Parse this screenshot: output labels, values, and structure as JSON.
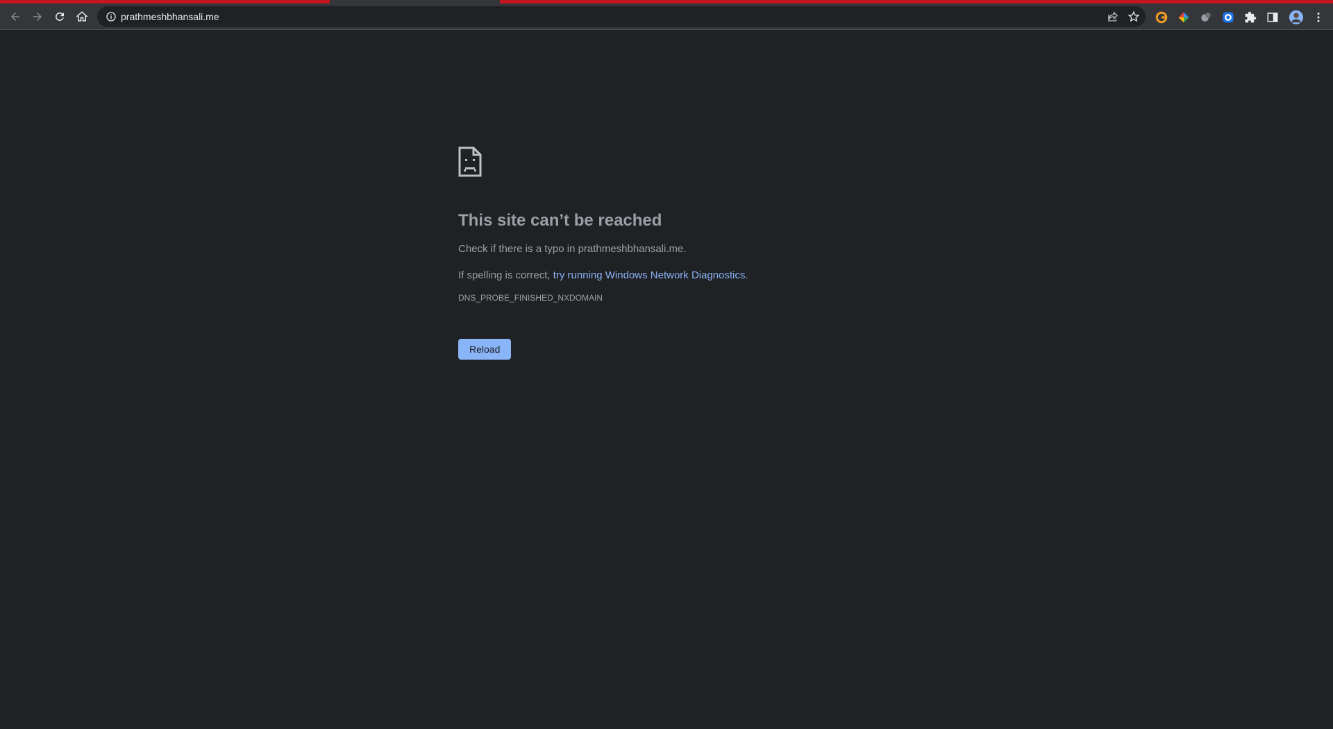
{
  "browser": {
    "url": "prathmeshbhansali.me",
    "nav": {
      "back": "back-icon",
      "forward": "forward-icon",
      "reload": "reload-icon",
      "home": "home-icon"
    },
    "extensions": [
      "grammarly-icon",
      "color-picker-icon",
      "extension-gray-icon",
      "extension-blue-icon",
      "puzzle-icon",
      "side-panel-icon",
      "profile-avatar",
      "more-menu-icon"
    ]
  },
  "error": {
    "title": "This site can’t be reached",
    "line1": "Check if there is a typo in prathmeshbhansali.me.",
    "line2_prefix": "If spelling is correct, ",
    "line2_link": "try running Windows Network Diagnostics",
    "line2_suffix": ".",
    "code": "DNS_PROBE_FINISHED_NXDOMAIN",
    "reload_label": "Reload"
  },
  "colors": {
    "background": "#202124",
    "toolbar": "#35363a",
    "accent_red": "#c5161d",
    "link": "#8ab4f8",
    "text": "#9aa0a6"
  }
}
